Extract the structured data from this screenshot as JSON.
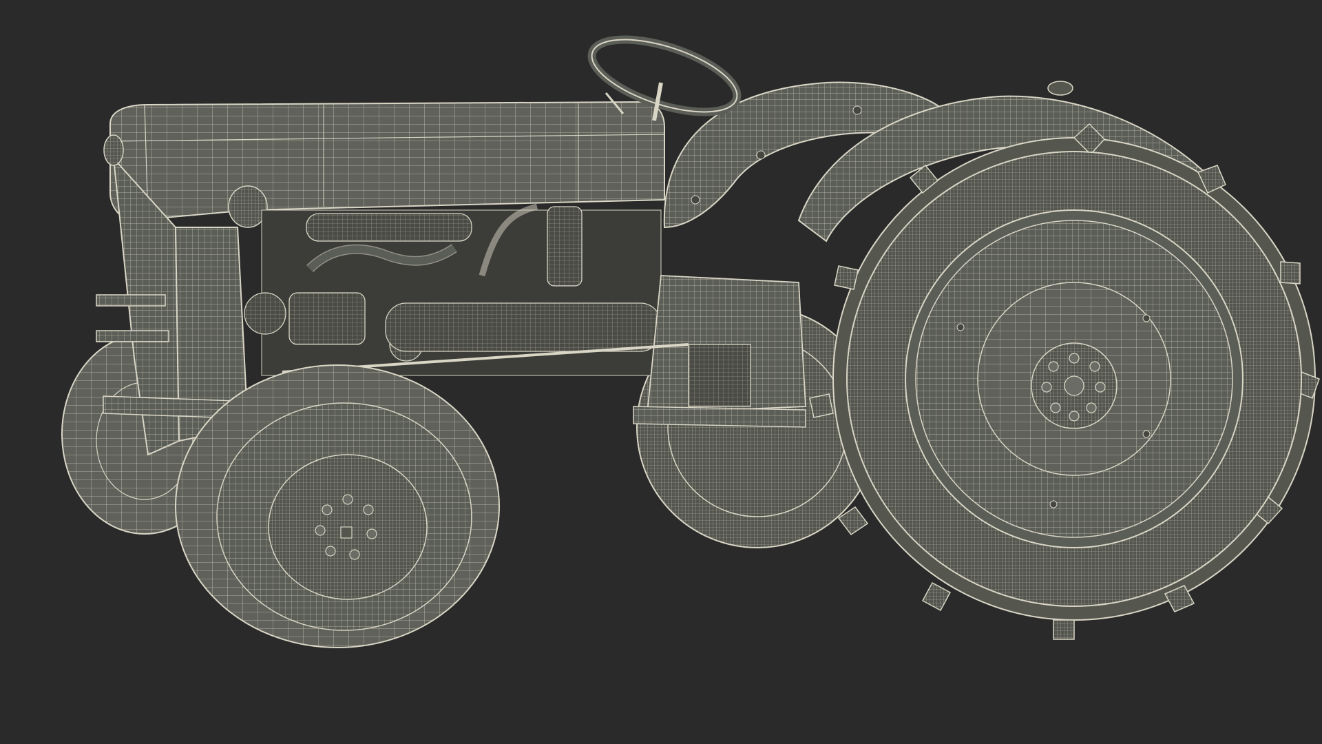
{
  "scene": {
    "subject": "tractor-wireframe-render",
    "render_style": "wireframe",
    "colors": {
      "background": "#2a2a2a",
      "body_fill": "#5b5d57",
      "body_fill_dark": "#45463f",
      "body_fill_light": "#6a6c65",
      "tire_fill": "#55574f",
      "wire": "#d9d6c6",
      "wire_faint": "#a9a796",
      "detail": "#2e2f2b"
    }
  }
}
